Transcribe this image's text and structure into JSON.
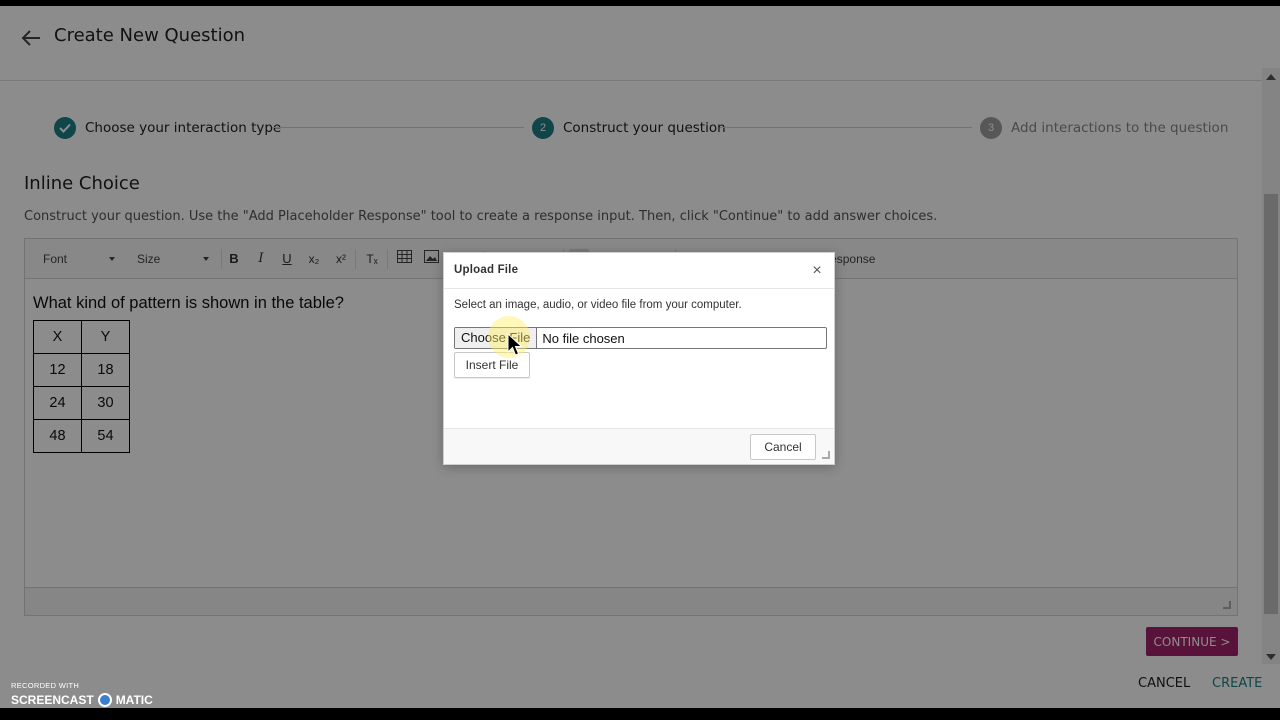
{
  "header": {
    "title": "Create New Question"
  },
  "stepper": {
    "steps": [
      {
        "number": "",
        "label": "Choose your interaction type",
        "state": "done"
      },
      {
        "number": "2",
        "label": "Construct your question",
        "state": "active"
      },
      {
        "number": "3",
        "label": "Add interactions to the question",
        "state": "pending"
      }
    ],
    "colors": {
      "active": "#1e7f87",
      "pending": "#9e9e9e"
    }
  },
  "section": {
    "title": "Inline Choice",
    "instructions": "Construct your question. Use the \"Add Placeholder Response\" tool to create a response input. Then, click \"Continue\" to add answer choices."
  },
  "editor": {
    "toolbar": {
      "font": "Font",
      "size": "Size",
      "bold": "B",
      "italic": "I",
      "underline": "U",
      "subscript": "x₂",
      "superscript": "x²",
      "remove_format": "Tₓ",
      "sigma": "Σ",
      "placeholder": "Add Placeholder Response"
    },
    "question": "What kind of pattern is shown in the table?",
    "table": {
      "headers": [
        "X",
        "Y"
      ],
      "rows": [
        [
          "12",
          "18"
        ],
        [
          "24",
          "30"
        ],
        [
          "48",
          "54"
        ]
      ]
    }
  },
  "actions": {
    "continue": "CONTINUE >",
    "cancel": "CANCEL",
    "create": "CREATE",
    "continue_color": "#a3236b"
  },
  "dialog": {
    "title": "Upload File",
    "close": "×",
    "description": "Select an image, audio, or video file from your computer.",
    "choose": "Choose File",
    "no_file": "No file chosen",
    "insert": "Insert File",
    "cancel": "Cancel"
  },
  "watermark": {
    "line1": "RECORDED WITH",
    "brand_left": "SCREENCAST",
    "brand_right": "MATIC"
  }
}
